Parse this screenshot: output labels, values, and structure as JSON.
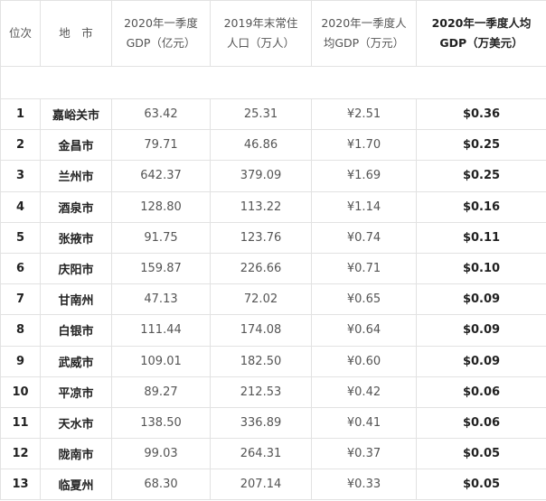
{
  "headers": {
    "rank": "位次",
    "city": "地　市",
    "gdp_l1": "2020年一季度",
    "gdp_l2": "GDP（亿元）",
    "pop_l1": "2019年末常住",
    "pop_l2": "人口（万人）",
    "pcny_l1": "2020年一季度人",
    "pcny_l2": "均GDP（万元）",
    "pusd_l1": "2020年一季度人均",
    "pusd_l2": "GDP（万美元）"
  },
  "rows": [
    {
      "rank": "1",
      "city": "嘉峪关市",
      "gdp": "63.42",
      "pop": "25.31",
      "cny": "¥2.51",
      "usd": "$0.36"
    },
    {
      "rank": "2",
      "city": "金昌市",
      "gdp": "79.71",
      "pop": "46.86",
      "cny": "¥1.70",
      "usd": "$0.25"
    },
    {
      "rank": "3",
      "city": "兰州市",
      "gdp": "642.37",
      "pop": "379.09",
      "cny": "¥1.69",
      "usd": "$0.25"
    },
    {
      "rank": "4",
      "city": "酒泉市",
      "gdp": "128.80",
      "pop": "113.22",
      "cny": "¥1.14",
      "usd": "$0.16"
    },
    {
      "rank": "5",
      "city": "张掖市",
      "gdp": "91.75",
      "pop": "123.76",
      "cny": "¥0.74",
      "usd": "$0.11"
    },
    {
      "rank": "6",
      "city": "庆阳市",
      "gdp": "159.87",
      "pop": "226.66",
      "cny": "¥0.71",
      "usd": "$0.10"
    },
    {
      "rank": "7",
      "city": "甘南州",
      "gdp": "47.13",
      "pop": "72.02",
      "cny": "¥0.65",
      "usd": "$0.09"
    },
    {
      "rank": "8",
      "city": "白银市",
      "gdp": "111.44",
      "pop": "174.08",
      "cny": "¥0.64",
      "usd": "$0.09"
    },
    {
      "rank": "9",
      "city": "武威市",
      "gdp": "109.01",
      "pop": "182.50",
      "cny": "¥0.60",
      "usd": "$0.09"
    },
    {
      "rank": "10",
      "city": "平凉市",
      "gdp": "89.27",
      "pop": "212.53",
      "cny": "¥0.42",
      "usd": "$0.06"
    },
    {
      "rank": "11",
      "city": "天水市",
      "gdp": "138.50",
      "pop": "336.89",
      "cny": "¥0.41",
      "usd": "$0.06"
    },
    {
      "rank": "12",
      "city": "陇南市",
      "gdp": "99.03",
      "pop": "264.31",
      "cny": "¥0.37",
      "usd": "$0.05"
    },
    {
      "rank": "13",
      "city": "临夏州",
      "gdp": "68.30",
      "pop": "207.14",
      "cny": "¥0.33",
      "usd": "$0.05"
    }
  ]
}
